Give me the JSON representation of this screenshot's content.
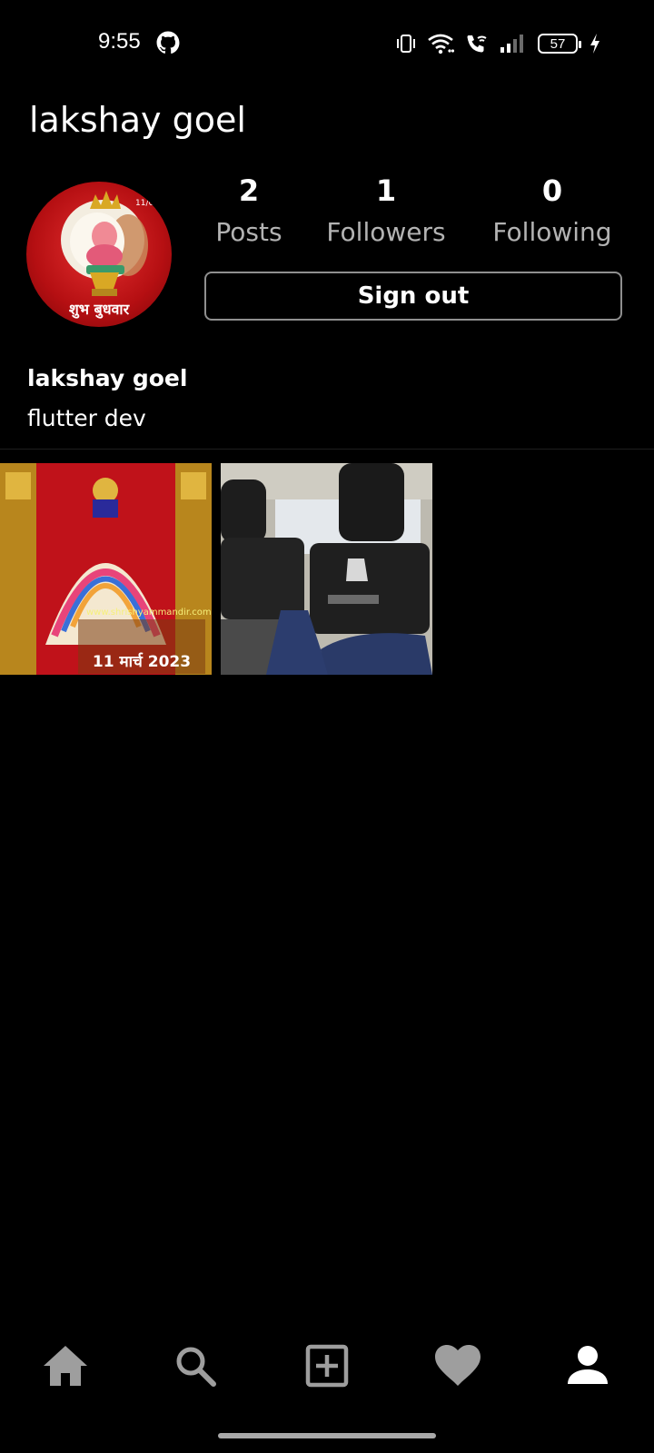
{
  "status_bar": {
    "time": "9:55",
    "battery_level": "57",
    "icons": [
      "github-icon",
      "vibrate-icon",
      "wifi-icon",
      "wifi-call-icon",
      "signal-icon",
      "battery-icon",
      "charging-icon"
    ]
  },
  "profile": {
    "title": "lakshay goel",
    "avatar_caption": "शुभ बुधवार",
    "display_name": "lakshay goel",
    "bio": "flutter dev"
  },
  "stats": {
    "posts": {
      "count": "2",
      "label": "Posts"
    },
    "followers": {
      "count": "1",
      "label": "Followers"
    },
    "following": {
      "count": "0",
      "label": "Following"
    }
  },
  "actions": {
    "sign_out_label": "Sign out"
  },
  "posts": [
    {
      "caption_lines": [
        "11 मार्च 2023"
      ]
    },
    {
      "caption_lines": []
    }
  ],
  "bottom_nav": {
    "items": [
      "home-icon",
      "search-icon",
      "add-post-icon",
      "heart-icon",
      "profile-icon"
    ],
    "active": "profile-icon"
  },
  "colors": {
    "background": "#000000",
    "text_primary": "#ffffff",
    "text_secondary": "#b3b3b3",
    "nav_inactive": "#9e9e9e",
    "nav_active": "#ffffff",
    "button_border": "#8f8f8f"
  }
}
